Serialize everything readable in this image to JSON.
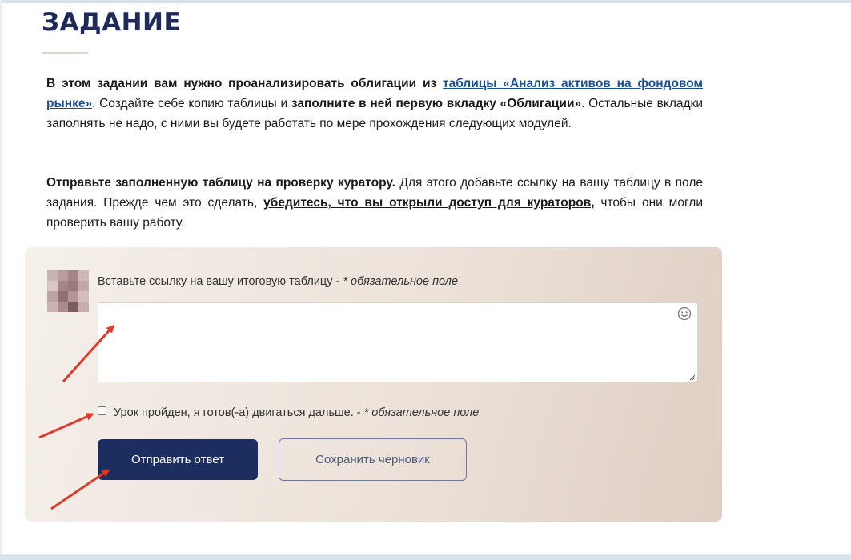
{
  "assignment": {
    "title": "ЗАДАНИЕ",
    "paragraph1": {
      "intro_bold": "В этом задании вам нужно проанализировать облигации из ",
      "link_text": "таблицы «Анализ активов на фондовом рынке»",
      "text_after_link": ". Создайте себе копию таблицы и ",
      "bold_instruction": "заполните в ней первую вкладку «Облигации»",
      "text_end": ". Остальные вкладки заполнять не надо, с ними вы будете работать по мере прохождения следующих модулей."
    },
    "paragraph2": {
      "bold_start": "Отправьте заполненную таблицу на проверку куратору.",
      "text_mid": " Для этого добавьте ссылку на вашу таблицу в поле задания. Прежде чем это сделать, ",
      "underlined_bold": "убедитесь, что вы открыли доступ для кураторов,",
      "text_end": " чтобы они могли проверить вашу работу."
    }
  },
  "form": {
    "link_field_label": "Вставьте ссылку на вашу итоговую таблицу - ",
    "link_field_required": "* обязательное поле",
    "link_field_value": "",
    "checkbox_label": "Урок пройден, я готов(-а) двигаться дальше. - ",
    "checkbox_required": "* обязательное поле",
    "checkbox_checked": false,
    "submit_label": "Отправить ответ",
    "draft_label": "Сохранить черновик"
  },
  "icons": {
    "emoji_picker": "smiley-icon",
    "textarea_resize": "resize-grip-icon",
    "user_avatar": "pixelated-avatar"
  },
  "colors": {
    "title": "#1e2a5a",
    "link": "#1e4f8c",
    "submit_button": "#1c2d60",
    "draft_border": "#6b7a99",
    "annotation_arrow": "#e03a2c"
  }
}
